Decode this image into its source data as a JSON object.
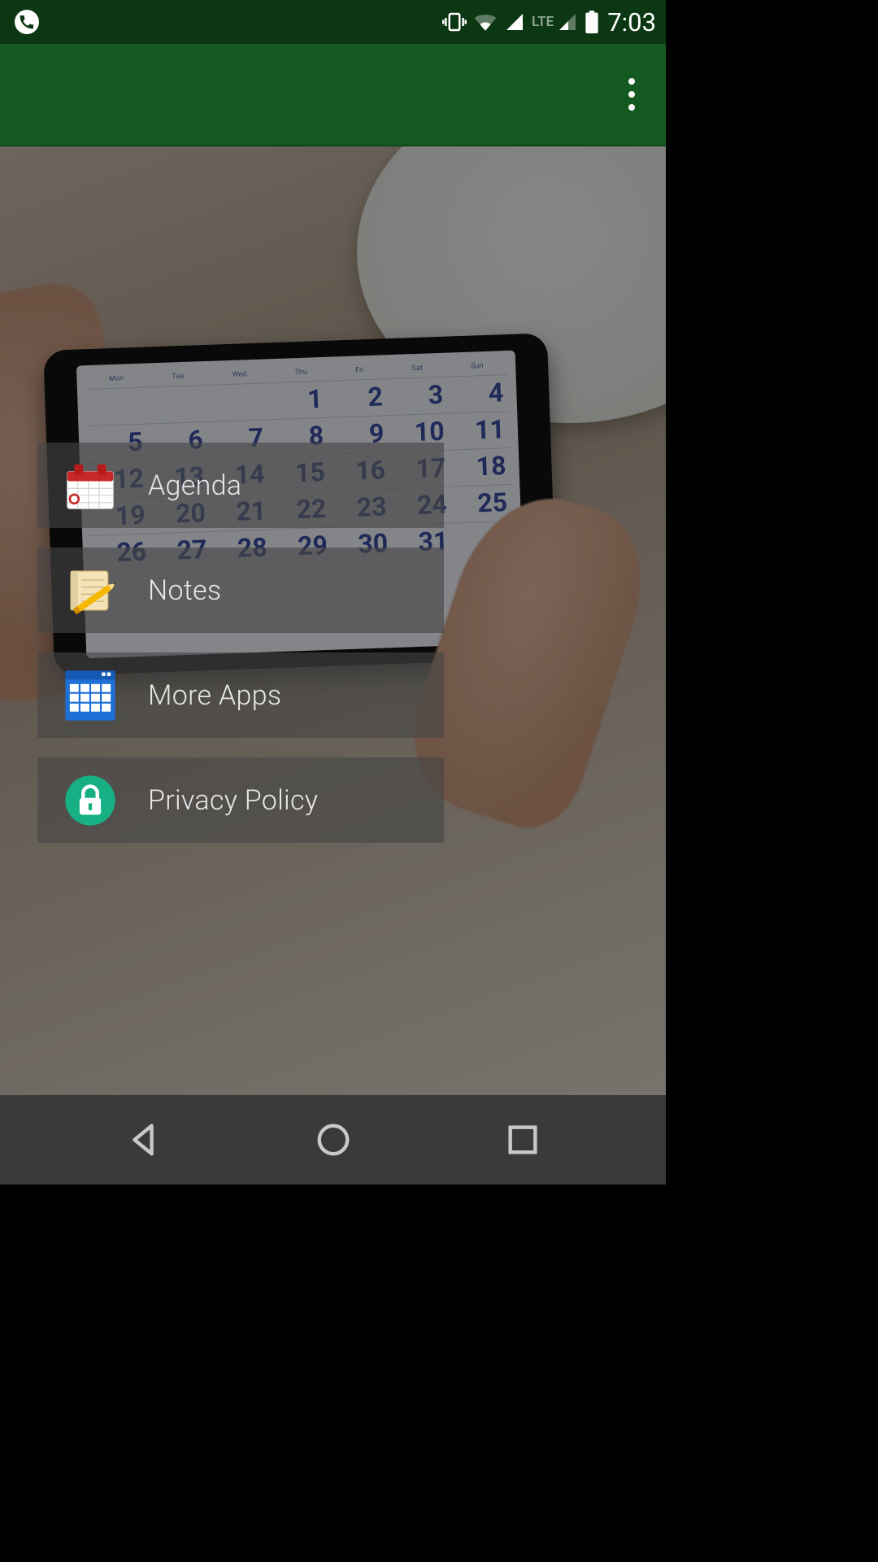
{
  "status_bar": {
    "lte_label": "LTE",
    "clock": "7:03"
  },
  "menu_items": [
    {
      "label": "Agenda"
    },
    {
      "label": "Notes"
    },
    {
      "label": "More Apps"
    },
    {
      "label": "Privacy Policy"
    }
  ]
}
